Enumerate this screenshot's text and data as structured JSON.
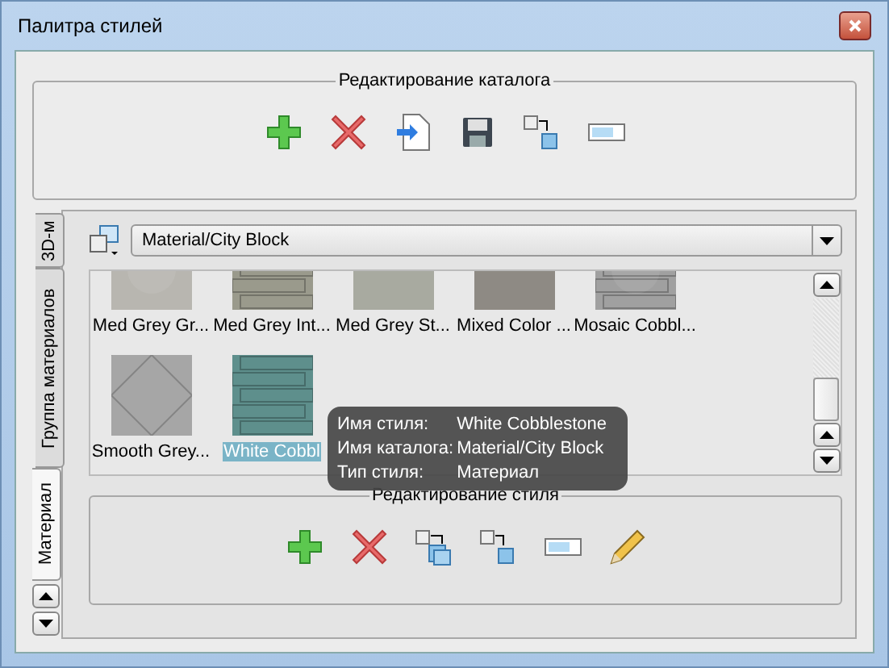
{
  "window": {
    "title": "Палитра стилей"
  },
  "catalog_editing": {
    "title": "Редактирование каталога",
    "tools": [
      {
        "kind": "add"
      },
      {
        "kind": "delete"
      },
      {
        "kind": "import"
      },
      {
        "kind": "save"
      },
      {
        "kind": "copy"
      },
      {
        "kind": "rename"
      }
    ]
  },
  "side_tabs": [
    {
      "label": "3D-м",
      "selected": false
    },
    {
      "label": "Группа материалов",
      "selected": false
    },
    {
      "label": "Материал",
      "selected": true
    }
  ],
  "catalog_path": "Material/City Block",
  "styles": [
    {
      "label": "Med Grey Gr...",
      "selected": false
    },
    {
      "label": "Med Grey Int...",
      "selected": false
    },
    {
      "label": "Med Grey St...",
      "selected": false
    },
    {
      "label": "Mixed Color ...",
      "selected": false
    },
    {
      "label": "Mosaic Cobbl...",
      "selected": false
    },
    {
      "label": "Smooth Grey...",
      "selected": false
    },
    {
      "label": "White Cobbl",
      "selected": true
    }
  ],
  "tooltip": [
    {
      "label": "Имя стиля:",
      "value": "White Cobblestone"
    },
    {
      "label": "Имя каталога:",
      "value": "Material/City Block"
    },
    {
      "label": "Тип стиля:",
      "value": "Материал"
    }
  ],
  "style_editing": {
    "title": "Редактирование стиля",
    "tools": [
      {
        "kind": "add"
      },
      {
        "kind": "delete"
      },
      {
        "kind": "copy_to"
      },
      {
        "kind": "copy"
      },
      {
        "kind": "rename"
      },
      {
        "kind": "edit"
      }
    ]
  }
}
